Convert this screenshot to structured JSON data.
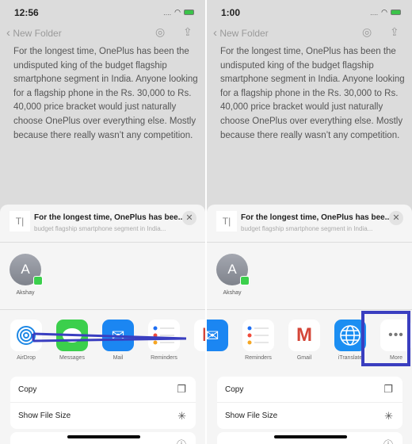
{
  "panels": [
    {
      "time": "12:56",
      "back": "New Folder",
      "note": "For the longest time, OnePlus has been the undisputed king of the budget flagship smartphone segment in India. Anyone looking for a flagship phone in the Rs. 30,000 to Rs. 40,000 price bracket would just naturally choose OnePlus over everything else. Mostly because there really wasn’t any competition.",
      "share_title": "For the longest time, OnePlus has bee...",
      "share_subtitle": "budget flagship smartphone segment in India...",
      "contact": {
        "initial": "A",
        "name": "Akshay"
      },
      "apps": [
        {
          "label": "AirDrop",
          "icon": "airdrop-icon"
        },
        {
          "label": "Messages",
          "icon": "messages-icon"
        },
        {
          "label": "Mail",
          "icon": "mail-icon"
        },
        {
          "label": "Reminders",
          "icon": "reminders-icon"
        },
        {
          "label": "",
          "icon": "gmail-icon"
        }
      ],
      "actions": [
        {
          "label": "Copy",
          "icon": "copy-icon"
        },
        {
          "label": "Show File Size",
          "icon": "spinner-icon"
        }
      ]
    },
    {
      "time": "1:00",
      "back": "New Folder",
      "note": "For the longest time, OnePlus has been the undisputed king of the budget flagship smartphone segment in India. Anyone looking for a flagship phone in the Rs. 30,000 to Rs. 40,000 price bracket would just naturally choose OnePlus over everything else. Mostly because there really wasn’t any competition.",
      "share_title": "For the longest time, OnePlus has bee...",
      "share_subtitle": "budget flagship smartphone segment in India...",
      "contact": {
        "initial": "A",
        "name": "Akshay"
      },
      "apps": [
        {
          "label": "",
          "icon": "mail-icon"
        },
        {
          "label": "Reminders",
          "icon": "reminders-icon"
        },
        {
          "label": "Gmail",
          "icon": "gmail-icon"
        },
        {
          "label": "iTranslate",
          "icon": "globe-icon"
        },
        {
          "label": "More",
          "icon": "more-icon"
        }
      ],
      "actions": [
        {
          "label": "Copy",
          "icon": "copy-icon"
        },
        {
          "label": "Show File Size",
          "icon": "spinner-icon"
        }
      ]
    }
  ],
  "annotation_color": "#3a3ec0"
}
